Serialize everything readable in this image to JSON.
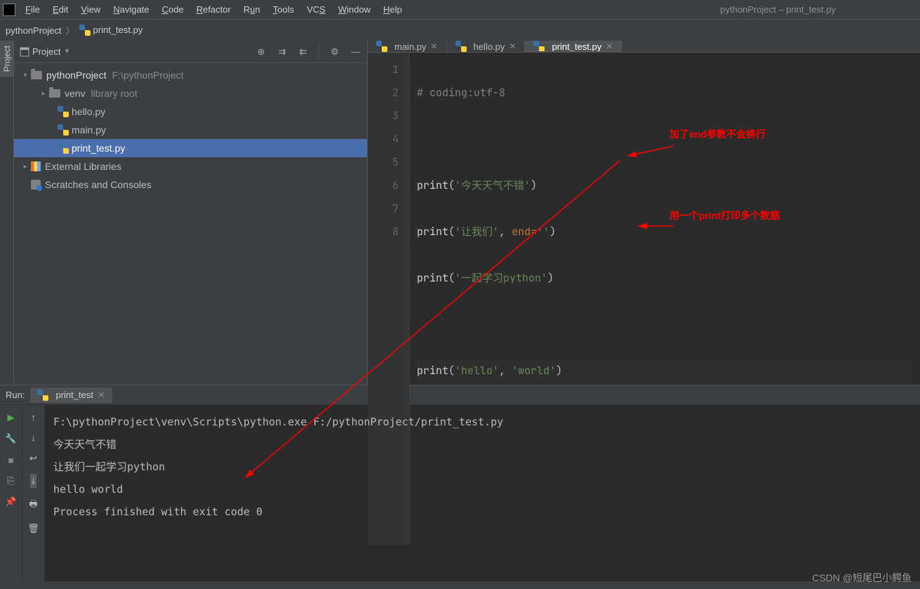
{
  "window": {
    "title": "pythonProject – print_test.py"
  },
  "menu": {
    "file": "File",
    "edit": "Edit",
    "view": "View",
    "navigate": "Navigate",
    "code": "Code",
    "refactor": "Refactor",
    "run": "Run",
    "tools": "Tools",
    "vcs": "VCS",
    "window": "Window",
    "help": "Help"
  },
  "breadcrumb": {
    "project": "pythonProject",
    "file": "print_test.py"
  },
  "projectPanel": {
    "title": "Project",
    "root": "pythonProject",
    "rootPath": "F:\\pythonProject",
    "venv": "venv",
    "venvNote": "library root",
    "files": {
      "hello": "hello.py",
      "main": "main.py",
      "print": "print_test.py"
    },
    "ext": "External Libraries",
    "scratch": "Scratches and Consoles"
  },
  "tabs": {
    "main": "main.py",
    "hello": "hello.py",
    "print": "print_test.py"
  },
  "gutter": {
    "l1": "1",
    "l2": "2",
    "l3": "3",
    "l4": "4",
    "l5": "5",
    "l6": "6",
    "l7": "7",
    "l8": "8"
  },
  "code": {
    "l1_comment": "# coding:utf-8",
    "print": "print",
    "op": "(",
    "cp": ")",
    "comma": ",",
    "s1": "'今天天气不错'",
    "s2": "'让我们'",
    "end_kw": "end",
    "eq": "=",
    "s_empty": "''",
    "s3": "'一起学习python'",
    "s4": "'hello'",
    "s5": "'world'"
  },
  "annotations": {
    "a1": "加了end参数不会换行",
    "a2": "用一个print打印多个数据"
  },
  "run": {
    "label": "Run:",
    "tab": "print_test",
    "cmd": "F:\\pythonProject\\venv\\Scripts\\python.exe F:/pythonProject/print_test.py",
    "o1": "今天天气不错",
    "o2": "让我们一起学习python",
    "o3": "hello world",
    "o4": "",
    "o5": "Process finished with exit code 0"
  },
  "sidebar": {
    "project": "Project"
  },
  "watermark": "CSDN @短尾巴小鳄鱼"
}
